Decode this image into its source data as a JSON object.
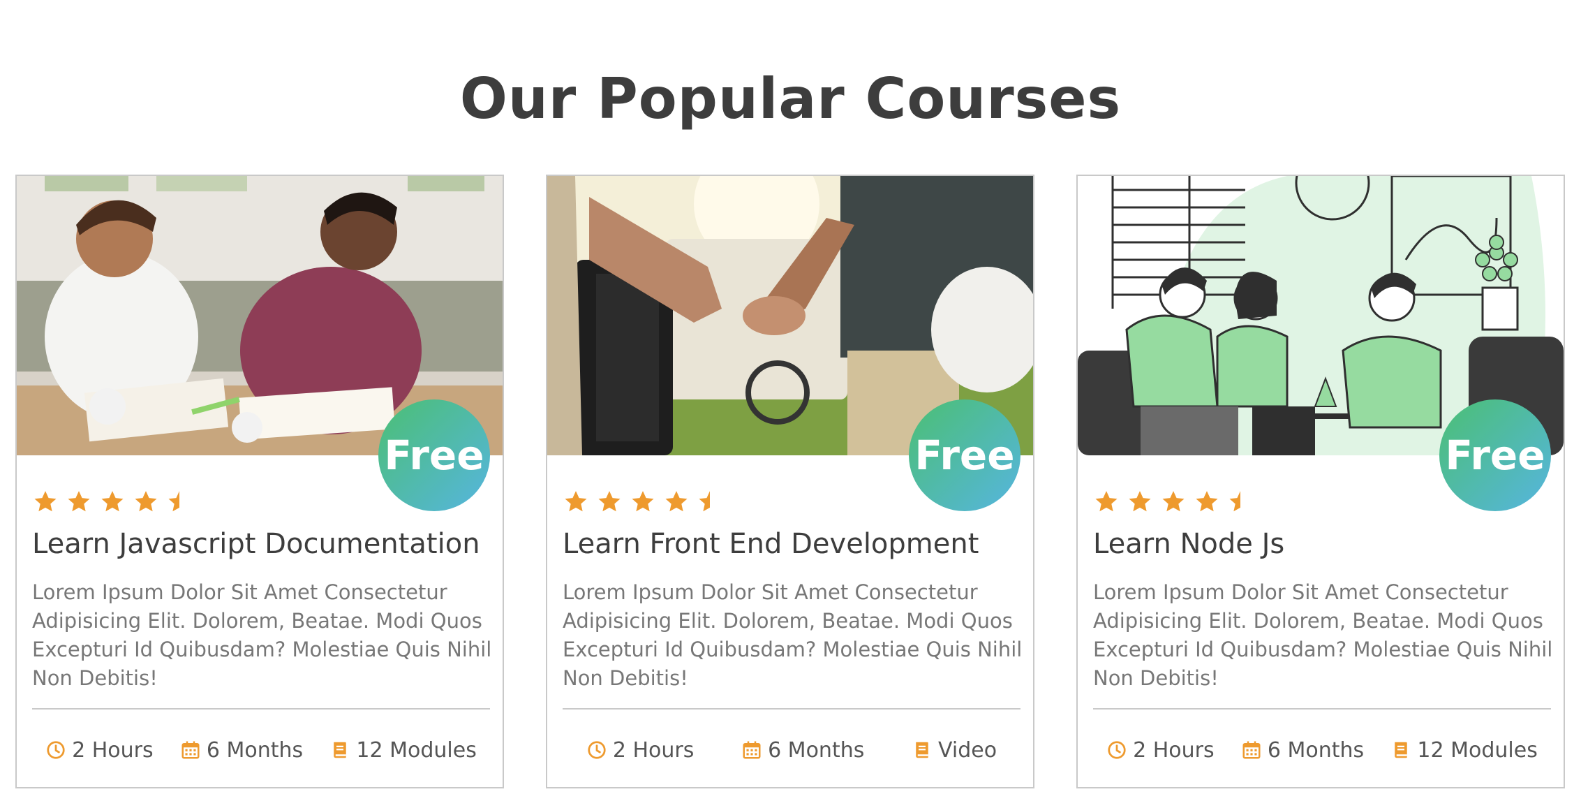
{
  "page": {
    "heading": "Our Popular Courses"
  },
  "colors": {
    "star": "#ee9a2e",
    "meta_icon": "#ee9a2e",
    "badge_from": "#4bbf73",
    "badge_to": "#56b5e0"
  },
  "courses": [
    {
      "image": "students-studying-photo",
      "badge": "Free",
      "rating": 4.5,
      "title": "Learn Javascript Documentation",
      "description": "Lorem Ipsum Dolor Sit Amet Consectetur Adipisicing Elit. Dolorem, Beatae. Modi Quos Excepturi Id Quibusdam? Molestiae Quis Nihil Non Debitis!",
      "meta": [
        {
          "icon": "clock-icon",
          "text": "2 Hours"
        },
        {
          "icon": "calendar-icon",
          "text": "6 Months"
        },
        {
          "icon": "book-icon",
          "text": "12 Modules"
        }
      ]
    },
    {
      "image": "handshake-golf-photo",
      "badge": "Free",
      "rating": 4.5,
      "title": "Learn Front End Development",
      "description": "Lorem Ipsum Dolor Sit Amet Consectetur Adipisicing Elit. Dolorem, Beatae. Modi Quos Excepturi Id Quibusdam? Molestiae Quis Nihil Non Debitis!",
      "meta": [
        {
          "icon": "clock-icon",
          "text": "2 Hours"
        },
        {
          "icon": "calendar-icon",
          "text": "6 Months"
        },
        {
          "icon": "book-icon",
          "text": "Video"
        }
      ]
    },
    {
      "image": "meeting-illustration",
      "badge": "Free",
      "rating": 4.5,
      "title": "Learn Node Js",
      "description": "Lorem Ipsum Dolor Sit Amet Consectetur Adipisicing Elit. Dolorem, Beatae. Modi Quos Excepturi Id Quibusdam? Molestiae Quis Nihil Non Debitis!",
      "meta": [
        {
          "icon": "clock-icon",
          "text": "2 Hours"
        },
        {
          "icon": "calendar-icon",
          "text": "6 Months"
        },
        {
          "icon": "book-icon",
          "text": "12 Modules"
        }
      ]
    }
  ]
}
